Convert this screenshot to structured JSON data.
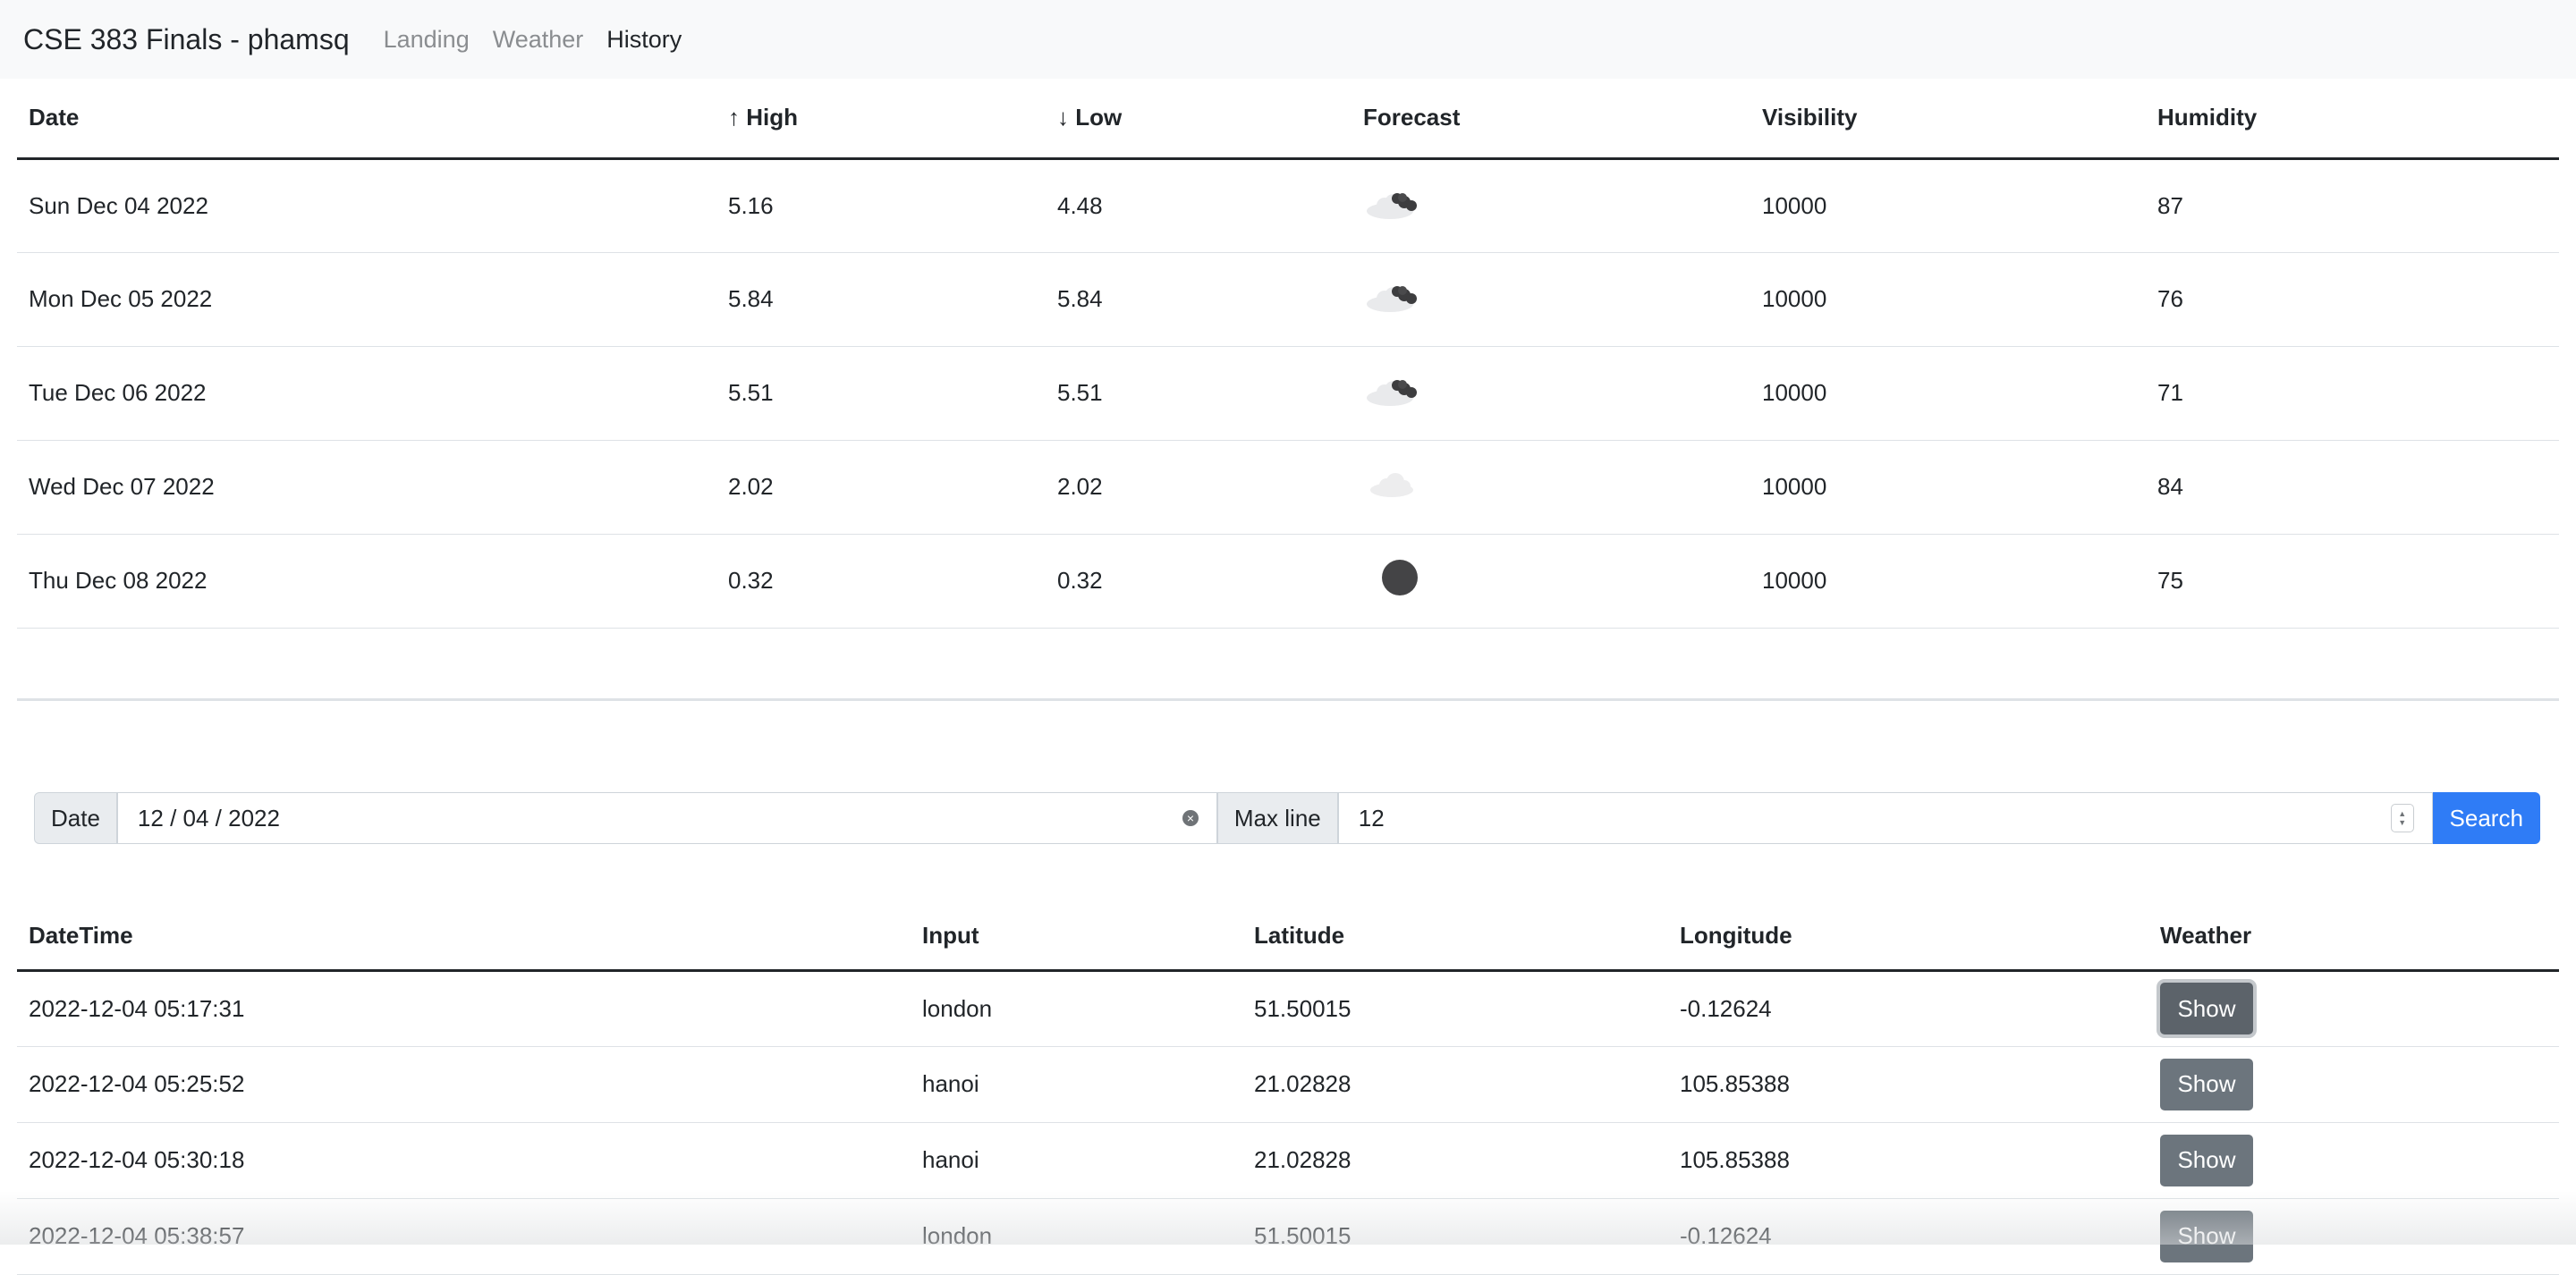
{
  "navbar": {
    "brand": "CSE 383 Finals - phamsq",
    "links": [
      {
        "label": "Landing"
      },
      {
        "label": "Weather"
      },
      {
        "label": "History"
      }
    ]
  },
  "forecast": {
    "headers": [
      "Date",
      "↑ High",
      "↓ Low",
      "Forecast",
      "Visibility",
      "Humidity"
    ],
    "rows": [
      {
        "date": "Sun Dec 04 2022",
        "high": "5.16",
        "low": "4.48",
        "icon": "broken-clouds-icon",
        "visibility": "10000",
        "humidity": "87"
      },
      {
        "date": "Mon Dec 05 2022",
        "high": "5.84",
        "low": "5.84",
        "icon": "broken-clouds-icon",
        "visibility": "10000",
        "humidity": "76"
      },
      {
        "date": "Tue Dec 06 2022",
        "high": "5.51",
        "low": "5.51",
        "icon": "broken-clouds-icon",
        "visibility": "10000",
        "humidity": "71"
      },
      {
        "date": "Wed Dec 07 2022",
        "high": "2.02",
        "low": "2.02",
        "icon": "cloud-icon",
        "visibility": "10000",
        "humidity": "84"
      },
      {
        "date": "Thu Dec 08 2022",
        "high": "0.32",
        "low": "0.32",
        "icon": "clear-sky-icon",
        "visibility": "10000",
        "humidity": "75"
      }
    ]
  },
  "search": {
    "date_label": "Date",
    "date_value": "12 / 04 / 2022",
    "maxline_label": "Max line",
    "maxline_value": "12",
    "button_label": "Search"
  },
  "history": {
    "headers": [
      "DateTime",
      "Input",
      "Latitude",
      "Longitude",
      "Weather"
    ],
    "rows": [
      {
        "datetime": "2022-12-04 05:17:31",
        "input": "london",
        "lat": "51.50015",
        "lon": "-0.12624",
        "action": "Show"
      },
      {
        "datetime": "2022-12-04 05:25:52",
        "input": "hanoi",
        "lat": "21.02828",
        "lon": "105.85388",
        "action": "Show"
      },
      {
        "datetime": "2022-12-04 05:30:18",
        "input": "hanoi",
        "lat": "21.02828",
        "lon": "105.85388",
        "action": "Show"
      },
      {
        "datetime": "2022-12-04 05:38:57",
        "input": "london",
        "lat": "51.50015",
        "lon": "-0.12624",
        "action": "Show"
      }
    ]
  },
  "colors": {
    "primary": "#2f7cf6",
    "secondary": "#6c757d",
    "navbar_bg": "#f8f9fa"
  }
}
